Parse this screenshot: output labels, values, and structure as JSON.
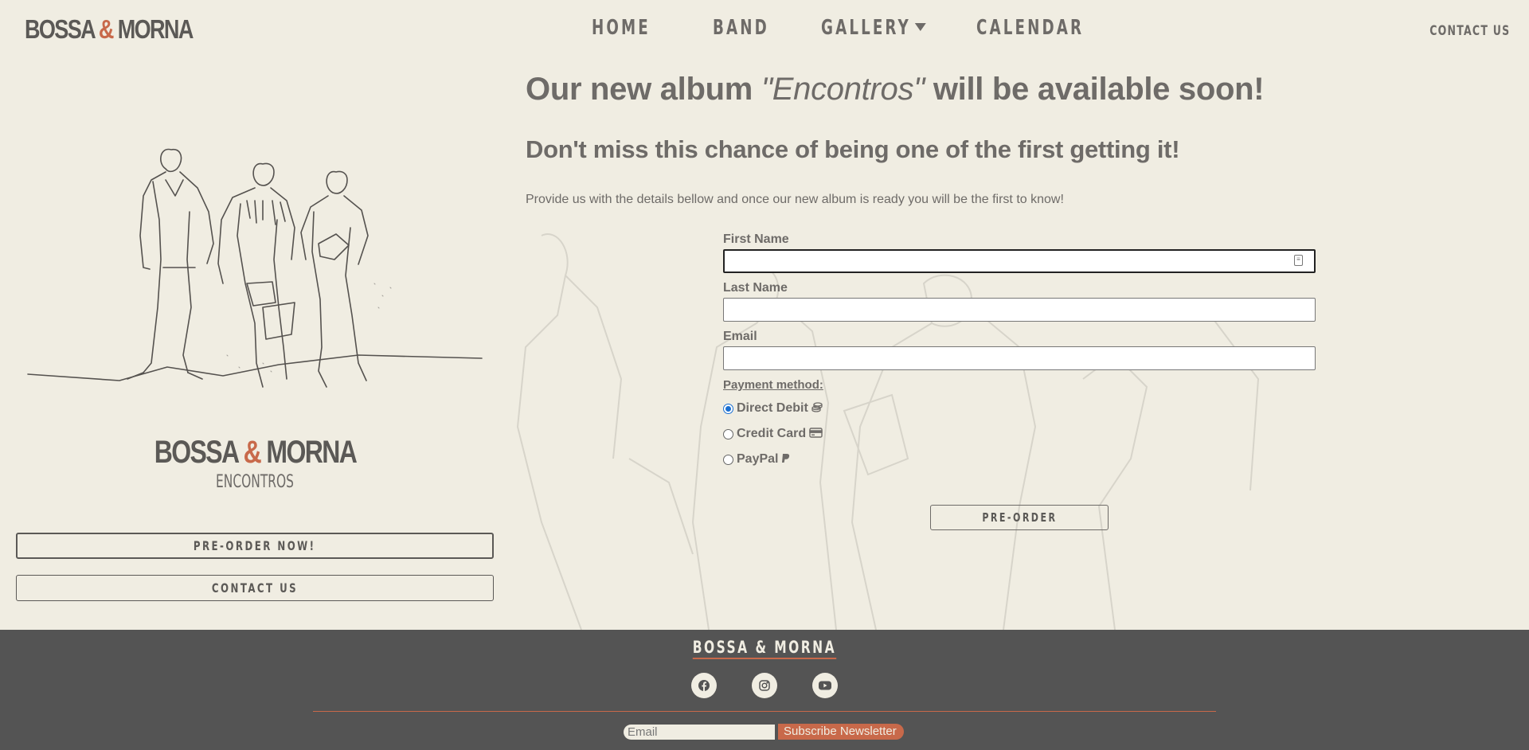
{
  "nav": {
    "brand_left": "BOSSA",
    "brand_amp": "&",
    "brand_right": "MORNA",
    "links": [
      "HOME",
      "BAND",
      "GALLERY",
      "CALENDAR"
    ],
    "contact": "CONTACT US"
  },
  "sidebar": {
    "album_brand_left": "BOSSA",
    "album_brand_amp": "&",
    "album_brand_right": "MORNA",
    "album_title": "ENCONTROS",
    "preorder_now": "PRE-ORDER NOW!",
    "contact": "CONTACT US"
  },
  "main": {
    "headline_pre": "Our new album ",
    "headline_album": "\"Encontros\"",
    "headline_post": " will be available soon!",
    "subheadline": "Don't miss this chance of being one of the first getting it!",
    "intro": "Provide us with the details bellow and once our new album is ready you will be the first to know!"
  },
  "form": {
    "first_name_label": "First Name",
    "first_name_value": "",
    "last_name_label": "Last Name",
    "last_name_value": "",
    "email_label": "Email",
    "email_value": "",
    "payment_title": "Payment method:",
    "payment_options": [
      {
        "label": "Direct Debit",
        "icon": "coins-icon",
        "checked": true
      },
      {
        "label": "Credit Card",
        "icon": "credit-card-icon",
        "checked": false
      },
      {
        "label": "PayPal",
        "icon": "paypal-icon",
        "checked": false
      }
    ],
    "submit": "PRE-ORDER"
  },
  "footer": {
    "brand": "BOSSA & MORNA",
    "socials": [
      "facebook-icon",
      "instagram-icon",
      "youtube-icon"
    ],
    "newsletter_placeholder": "Email",
    "newsletter_button": "Subscribe Newsletter"
  },
  "colors": {
    "background": "#f0ede2",
    "text": "#6e6b68",
    "accent": "#c8694a",
    "footer": "#545454"
  }
}
